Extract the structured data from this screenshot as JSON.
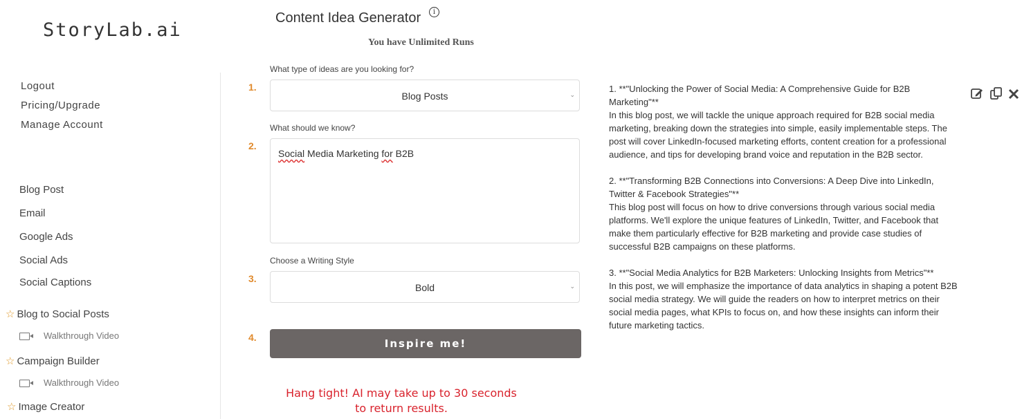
{
  "brand": {
    "logo": "StoryLab.ai"
  },
  "account_menu": [
    {
      "label": "Logout"
    },
    {
      "label": "Pricing/Upgrade"
    },
    {
      "label": "Manage Account"
    }
  ],
  "tools": {
    "blog_post": "Blog Post",
    "email": "Email",
    "google_ads": "Google Ads",
    "social_ads": "Social Ads",
    "social_captions": "Social Captions",
    "blog_to_social": "Blog to Social Posts",
    "walkthrough_1": "Walkthrough Video",
    "campaign_builder": "Campaign Builder",
    "walkthrough_2": "Walkthrough Video",
    "image_creator": "Image Creator"
  },
  "header": {
    "title": "Content Idea Generator",
    "info_glyph": "i",
    "runs": "You have Unlimited Runs"
  },
  "form": {
    "steps": [
      "1.",
      "2.",
      "3.",
      "4."
    ],
    "q1_label": "What type of ideas are you looking for?",
    "q1_value": "Blog Posts",
    "q2_label": "What should we know?",
    "q2_value_part1": "Social",
    "q2_value_part2": " Media Marketing ",
    "q2_value_part3": "for",
    "q2_value_part4": " B2B",
    "q3_label": "Choose a Writing Style",
    "q3_value": "Bold",
    "submit_label": "Inspire me!",
    "wait_line1": "Hang tight! AI may take up to 30 seconds",
    "wait_line2": "to return results."
  },
  "results": [
    {
      "heading": "1. **\"Unlocking the Power of Social Media: A Comprehensive Guide for B2B Marketing\"**",
      "body": "In this blog post, we will tackle the unique approach required for B2B social media marketing, breaking down the strategies into simple, easily implementable steps. The post will cover LinkedIn-focused marketing efforts, content creation for a professional audience, and tips for developing brand voice and reputation in the B2B sector."
    },
    {
      "heading": "2. **\"Transforming B2B Connections into Conversions: A Deep Dive into LinkedIn, Twitter & Facebook Strategies\"**",
      "body": "This blog post will focus on how to drive conversions through various social media platforms. We'll explore the unique features of LinkedIn, Twitter, and Facebook that make them particularly effective for B2B marketing and provide case studies of successful B2B campaigns on these platforms."
    },
    {
      "heading": "3. **\"Social Media Analytics for B2B Marketers: Unlocking Insights from Metrics\"**",
      "body": "In this post, we will emphasize the importance of data analytics in shaping a potent B2B social media strategy. We will guide the readers on how to interpret metrics on their social media pages, what KPIs to focus on, and how these insights can inform their future marketing tactics."
    }
  ],
  "icons": {
    "edit": "edit-icon",
    "copy": "copy-icon",
    "close": "close-icon",
    "star": "star-icon",
    "video": "video-camera-icon",
    "chevron": "chevron-down-icon",
    "info": "info-icon"
  },
  "colors": {
    "accent_orange": "#e08a2c",
    "button_bg": "#6b6665",
    "warning_red": "#d9232d"
  }
}
